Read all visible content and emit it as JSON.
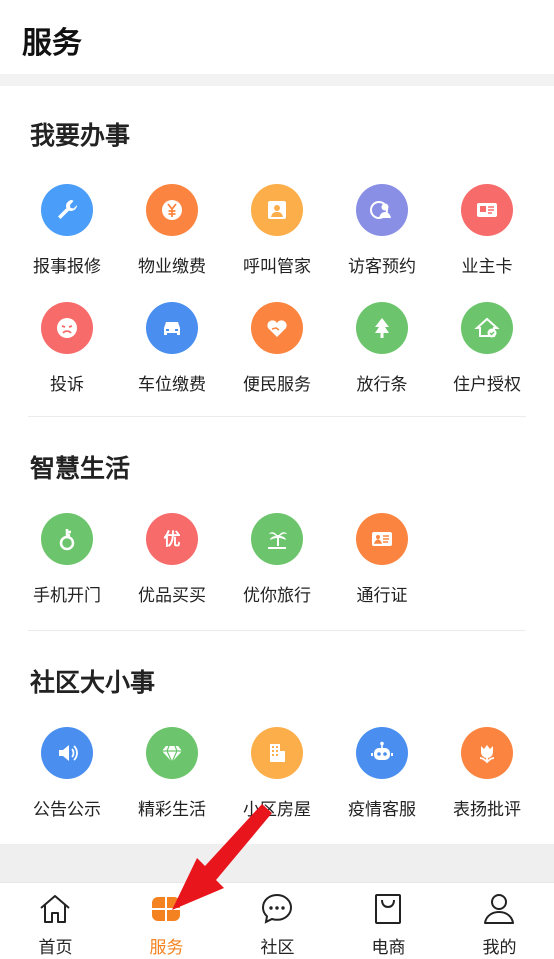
{
  "header": {
    "title": "服务"
  },
  "sections": [
    {
      "title": "我要办事",
      "items": [
        {
          "label": "报事报修",
          "icon": "wrench-icon",
          "color": "#4a9df8"
        },
        {
          "label": "物业缴费",
          "icon": "yen-icon",
          "color": "#fb8540"
        },
        {
          "label": "呼叫管家",
          "icon": "butler-icon",
          "color": "#fbae4a"
        },
        {
          "label": "访客预约",
          "icon": "visitor-icon",
          "color": "#8a8fe6"
        },
        {
          "label": "业主卡",
          "icon": "card-icon",
          "color": "#f86b6b"
        },
        {
          "label": "投诉",
          "icon": "sad-face-icon",
          "color": "#f86b6b"
        },
        {
          "label": "车位缴费",
          "icon": "car-icon",
          "color": "#4a8ff0"
        },
        {
          "label": "便民服务",
          "icon": "heart-hand-icon",
          "color": "#fb8540"
        },
        {
          "label": "放行条",
          "icon": "tree-up-icon",
          "color": "#6cc56c"
        },
        {
          "label": "住户授权",
          "icon": "house-check-icon",
          "color": "#6cc56c"
        }
      ]
    },
    {
      "title": "智慧生活",
      "items": [
        {
          "label": "手机开门",
          "icon": "key-icon",
          "color": "#6cc56c"
        },
        {
          "label": "优品买买",
          "icon": "you-icon",
          "color": "#f86b6b"
        },
        {
          "label": "优你旅行",
          "icon": "palm-tree-icon",
          "color": "#6cc56c"
        },
        {
          "label": "通行证",
          "icon": "pass-card-icon",
          "color": "#fb8540"
        }
      ]
    },
    {
      "title": "社区大小事",
      "items": [
        {
          "label": "公告公示",
          "icon": "speaker-icon",
          "color": "#4a8ff0"
        },
        {
          "label": "精彩生活",
          "icon": "diamond-icon",
          "color": "#6cc56c"
        },
        {
          "label": "小区房屋",
          "icon": "building-icon",
          "color": "#fbae4a"
        },
        {
          "label": "疫情客服",
          "icon": "robot-icon",
          "color": "#4a8ff0"
        },
        {
          "label": "表扬批评",
          "icon": "tulip-icon",
          "color": "#fb8540"
        }
      ]
    }
  ],
  "tabbar": {
    "tabs": [
      {
        "label": "首页",
        "icon": "home-icon",
        "active": false
      },
      {
        "label": "服务",
        "icon": "service-icon",
        "active": true
      },
      {
        "label": "社区",
        "icon": "chat-icon",
        "active": false
      },
      {
        "label": "电商",
        "icon": "shopping-bag-icon",
        "active": false
      },
      {
        "label": "我的",
        "icon": "user-icon",
        "active": false
      }
    ]
  },
  "colors": {
    "accent": "#f58220",
    "annotation_arrow": "#e8161c"
  }
}
